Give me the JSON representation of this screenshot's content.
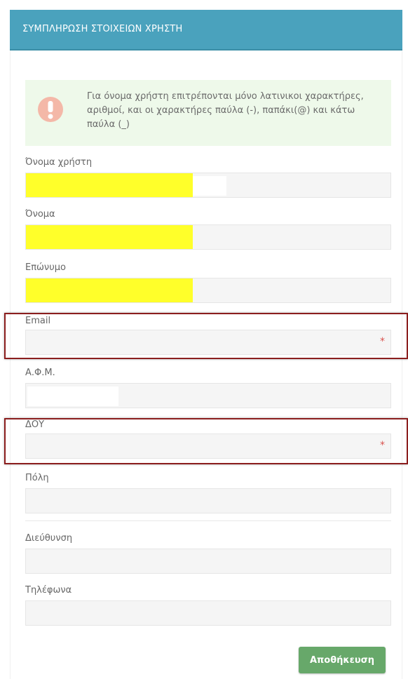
{
  "header": {
    "title": "ΣΥΜΠΛΗΡΩΣΗ ΣΤΟΙΧΕΙΩΝ ΧΡΗΣΤΗ"
  },
  "alert": {
    "icon": "exclamation-icon",
    "text": "Για όνομα χρήστη επιτρέπονται μόνο λατινικοι χαρακτήρες, αριθμοί, και οι χαρακτήρες παύλα (-), παπάκι(@) και κάτω παύλα (_)"
  },
  "fields": {
    "username": {
      "label": "Όνομα χρήστη",
      "value": ""
    },
    "first_name": {
      "label": "Όνομα",
      "value": ""
    },
    "last_name": {
      "label": "Επώνυμο",
      "value": ""
    },
    "email": {
      "label": "Email",
      "value": "",
      "required_mark": "*"
    },
    "afm": {
      "label": "Α.Φ.Μ.",
      "value": ""
    },
    "doy": {
      "label": "ΔΟΥ",
      "value": "",
      "required_mark": "*"
    },
    "city": {
      "label": "Πόλη",
      "value": ""
    },
    "address": {
      "label": "Διεύθυνση",
      "value": ""
    },
    "phones": {
      "label": "Τηλέφωνα",
      "value": ""
    }
  },
  "actions": {
    "save_label": "Αποθήκευση"
  },
  "colors": {
    "header": "#4aa2bd",
    "alert_bg": "#eef9ea",
    "redaction": "#ffff2a",
    "required": "#d9534f",
    "highlight_border": "#8b1e1e",
    "save_button": "#67a86a"
  }
}
